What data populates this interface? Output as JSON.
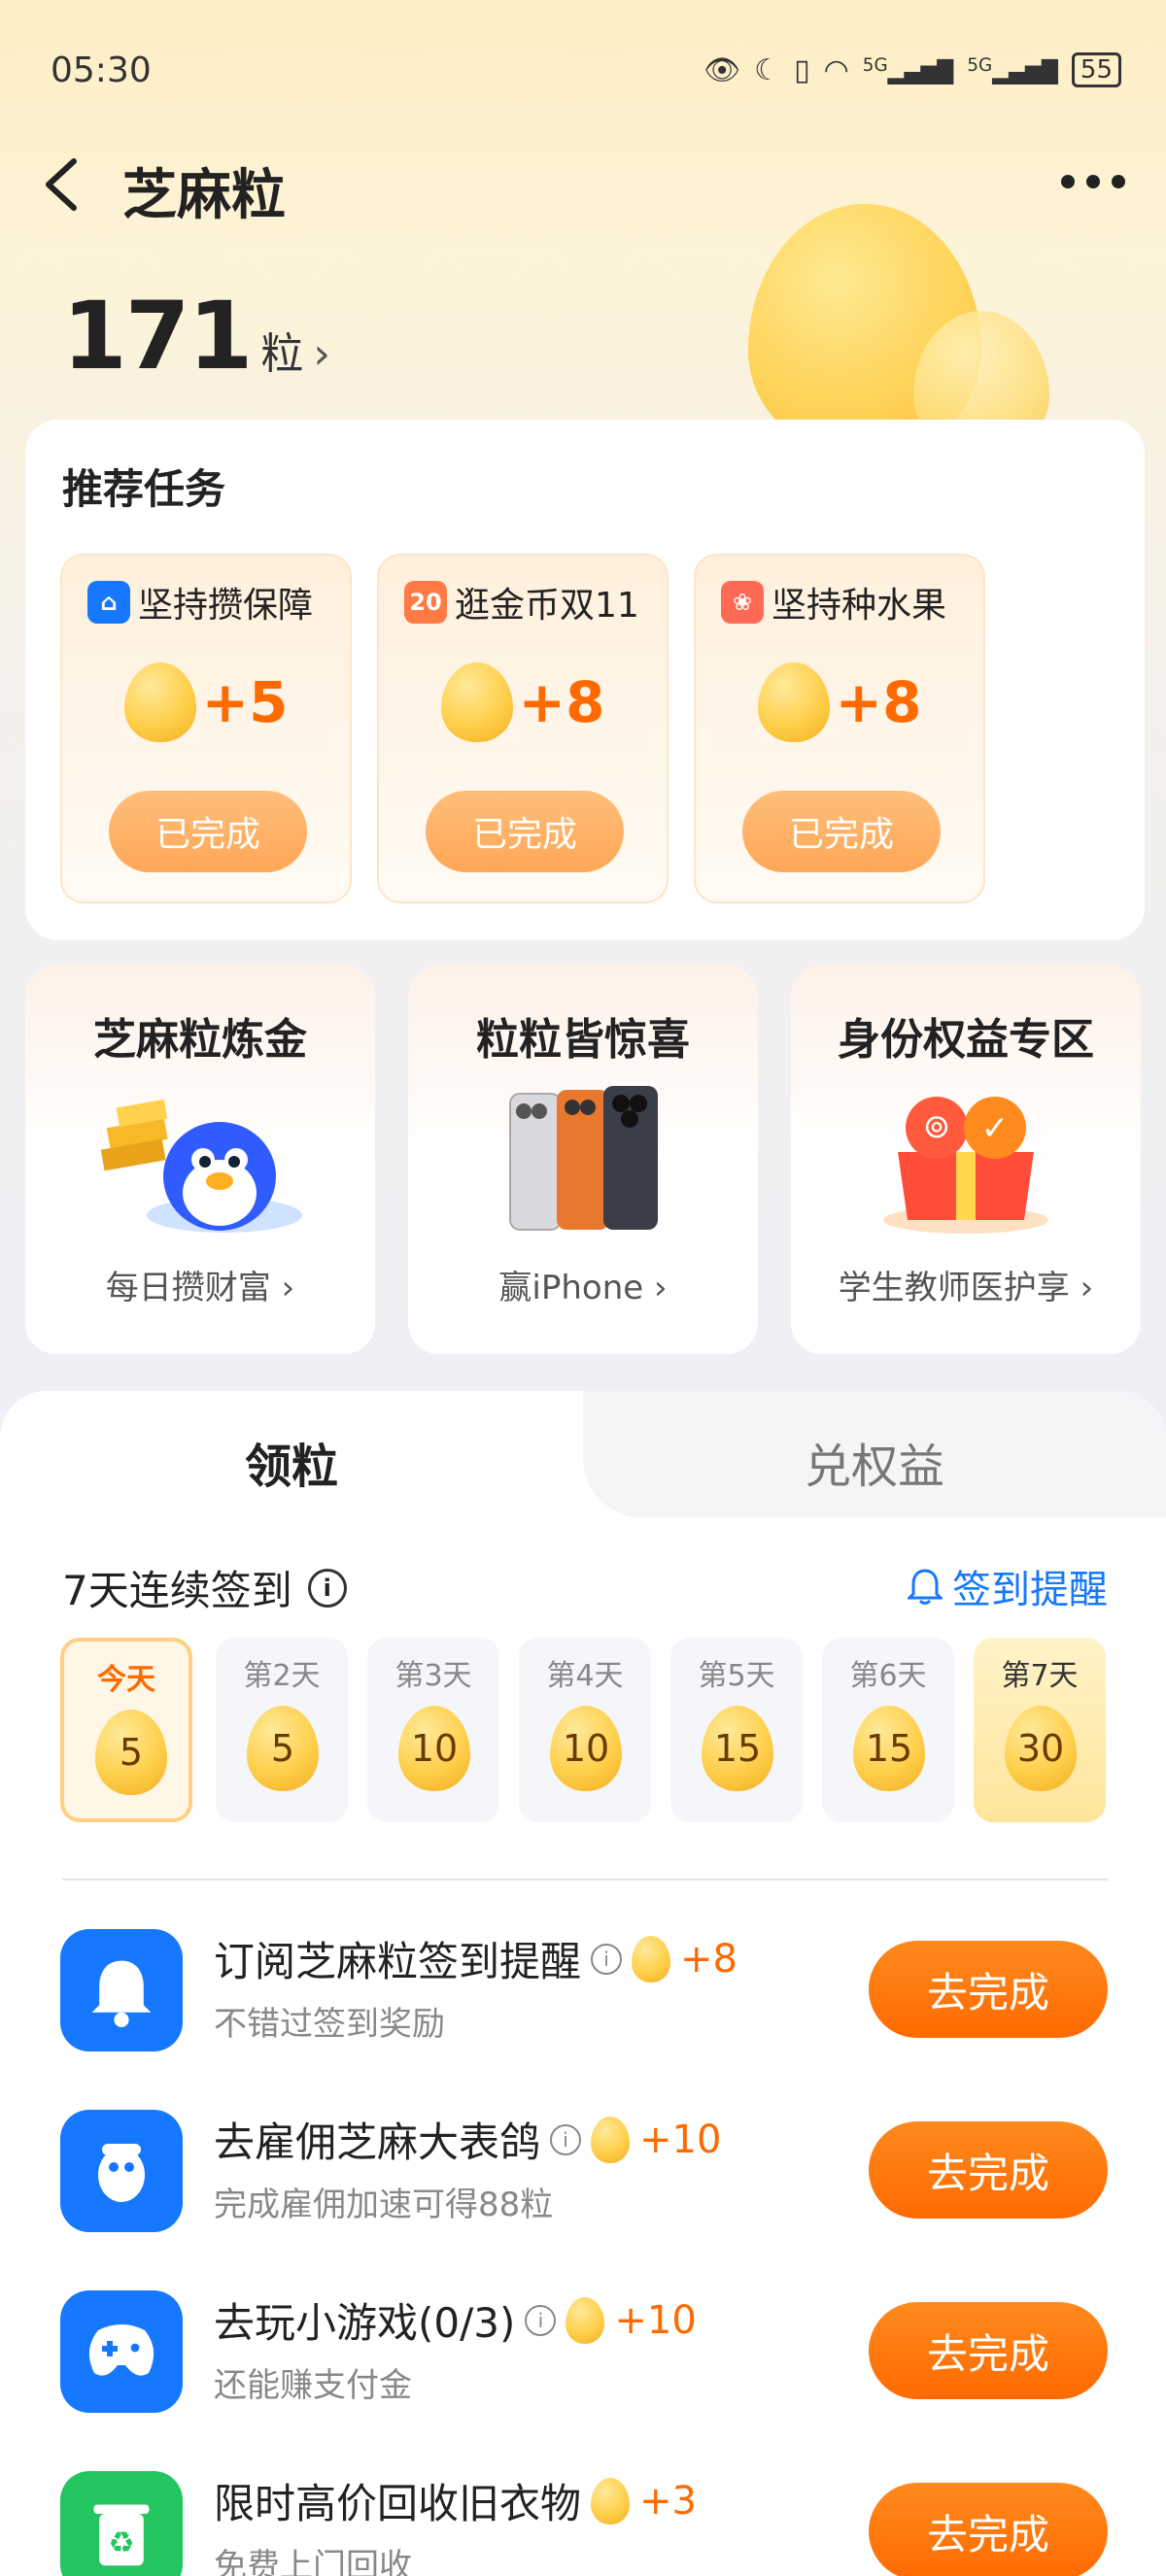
{
  "status_bar": {
    "time": "05:30",
    "battery": "55",
    "network1": "5G",
    "network2": "5G"
  },
  "nav": {
    "title": "芝麻粒"
  },
  "points": {
    "value": "171",
    "unit": "粒",
    "chevron": "›"
  },
  "recommended": {
    "title": "推荐任务",
    "tasks": [
      {
        "name": "坚持攒保障",
        "points": "+5",
        "button": "已完成",
        "icon_color": "#1677ff"
      },
      {
        "name": "逛金币双11",
        "points": "+8",
        "button": "已完成",
        "icon_color": "#ff7a45",
        "icon_text": "20"
      },
      {
        "name": "坚持种水果",
        "points": "+8",
        "button": "已完成",
        "icon_color": "#ff6a55"
      }
    ]
  },
  "features": [
    {
      "title": "芝麻粒炼金",
      "subtitle": "每日攒财富 ›"
    },
    {
      "title": "粒粒皆惊喜",
      "subtitle": "赢iPhone ›"
    },
    {
      "title": "身份权益专区",
      "subtitle": "学生教师医护享 ›"
    }
  ],
  "tabs": {
    "left": "领粒",
    "right": "兑权益"
  },
  "checkin": {
    "title": "7天连续签到",
    "info": "i",
    "remind_label": "签到提醒",
    "days": [
      {
        "label": "今天",
        "value": "5"
      },
      {
        "label": "第2天",
        "value": "5"
      },
      {
        "label": "第3天",
        "value": "10"
      },
      {
        "label": "第4天",
        "value": "10"
      },
      {
        "label": "第5天",
        "value": "15"
      },
      {
        "label": "第6天",
        "value": "15"
      },
      {
        "label": "第7天",
        "value": "30"
      }
    ]
  },
  "task_list": [
    {
      "title": "订阅芝麻粒签到提醒",
      "subtitle": "不错过签到奖励",
      "reward": "+8",
      "button": "去完成",
      "icon": "bell-icon",
      "color": "#1677ff"
    },
    {
      "title": "去雇佣芝麻大表鸽",
      "subtitle": "完成雇佣加速可得88粒",
      "reward": "+10",
      "button": "去完成",
      "icon": "pigeon-icon",
      "color": "#1677ff"
    },
    {
      "title": "去玩小游戏(0/3)",
      "subtitle": "还能赚支付金",
      "reward": "+10",
      "button": "去完成",
      "icon": "gamepad-icon",
      "color": "#1677ff"
    },
    {
      "title": "限时高价回收旧衣物",
      "subtitle": "免费上门回收",
      "reward": "+3",
      "button": "去完成",
      "icon": "recycle-bin-icon",
      "color": "#22c55e"
    }
  ]
}
